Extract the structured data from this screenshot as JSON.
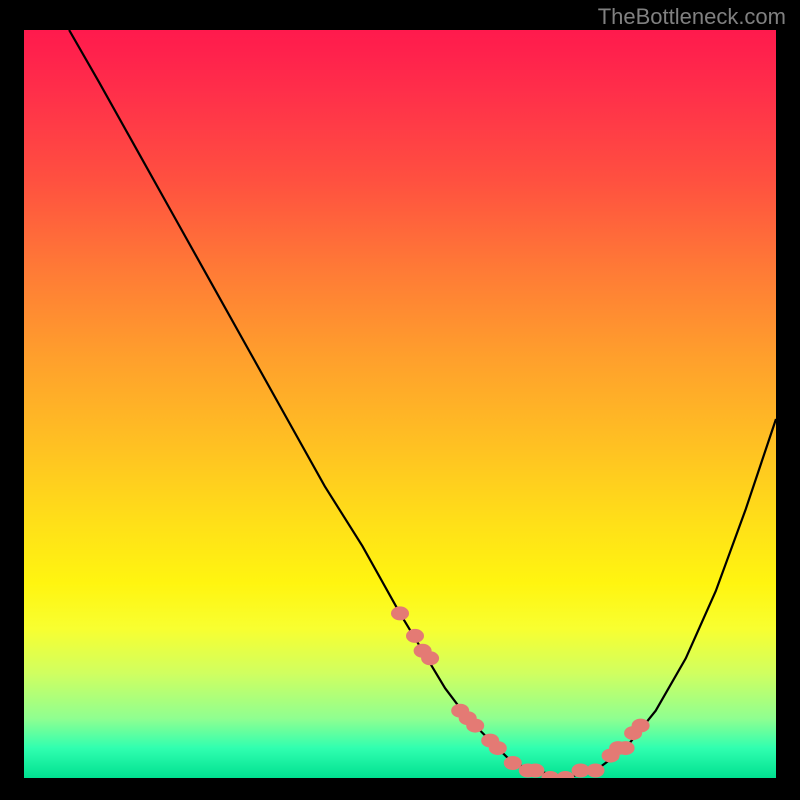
{
  "watermark": "TheBottleneck.com",
  "chart_data": {
    "type": "line",
    "title": "",
    "xlabel": "",
    "ylabel": "",
    "xlim": [
      0,
      100
    ],
    "ylim": [
      0,
      100
    ],
    "series": [
      {
        "name": "bottleneck-curve",
        "x": [
          6,
          10,
          15,
          20,
          25,
          30,
          35,
          40,
          45,
          50,
          53,
          56,
          59,
          62,
          65,
          68,
          72,
          76,
          80,
          84,
          88,
          92,
          96,
          100
        ],
        "y": [
          100,
          93,
          84,
          75,
          66,
          57,
          48,
          39,
          31,
          22,
          17,
          12,
          8,
          5,
          2,
          1,
          0,
          1,
          4,
          9,
          16,
          25,
          36,
          48
        ],
        "color": "#000000"
      }
    ],
    "markers": {
      "name": "highlight-points",
      "color": "#e47a74",
      "points_x": [
        50,
        52,
        53,
        54,
        58,
        59,
        60,
        62,
        63,
        65,
        67,
        68,
        70,
        72,
        74,
        76,
        78,
        79,
        80,
        81,
        82
      ],
      "points_y": [
        22,
        19,
        17,
        16,
        9,
        8,
        7,
        5,
        4,
        2,
        1,
        1,
        0,
        0,
        1,
        1,
        3,
        4,
        4,
        6,
        7
      ]
    },
    "gradient_bands": [
      {
        "color": "#ff1a4d",
        "stop": 0
      },
      {
        "color": "#ff2e4a",
        "stop": 8
      },
      {
        "color": "#ff5040",
        "stop": 20
      },
      {
        "color": "#ff7a36",
        "stop": 32
      },
      {
        "color": "#ffa02c",
        "stop": 44
      },
      {
        "color": "#ffc222",
        "stop": 56
      },
      {
        "color": "#ffe018",
        "stop": 66
      },
      {
        "color": "#fff510",
        "stop": 74
      },
      {
        "color": "#f8ff30",
        "stop": 80
      },
      {
        "color": "#d0ff60",
        "stop": 86
      },
      {
        "color": "#90ff90",
        "stop": 92
      },
      {
        "color": "#30ffb0",
        "stop": 96
      },
      {
        "color": "#00e090",
        "stop": 100
      }
    ]
  }
}
